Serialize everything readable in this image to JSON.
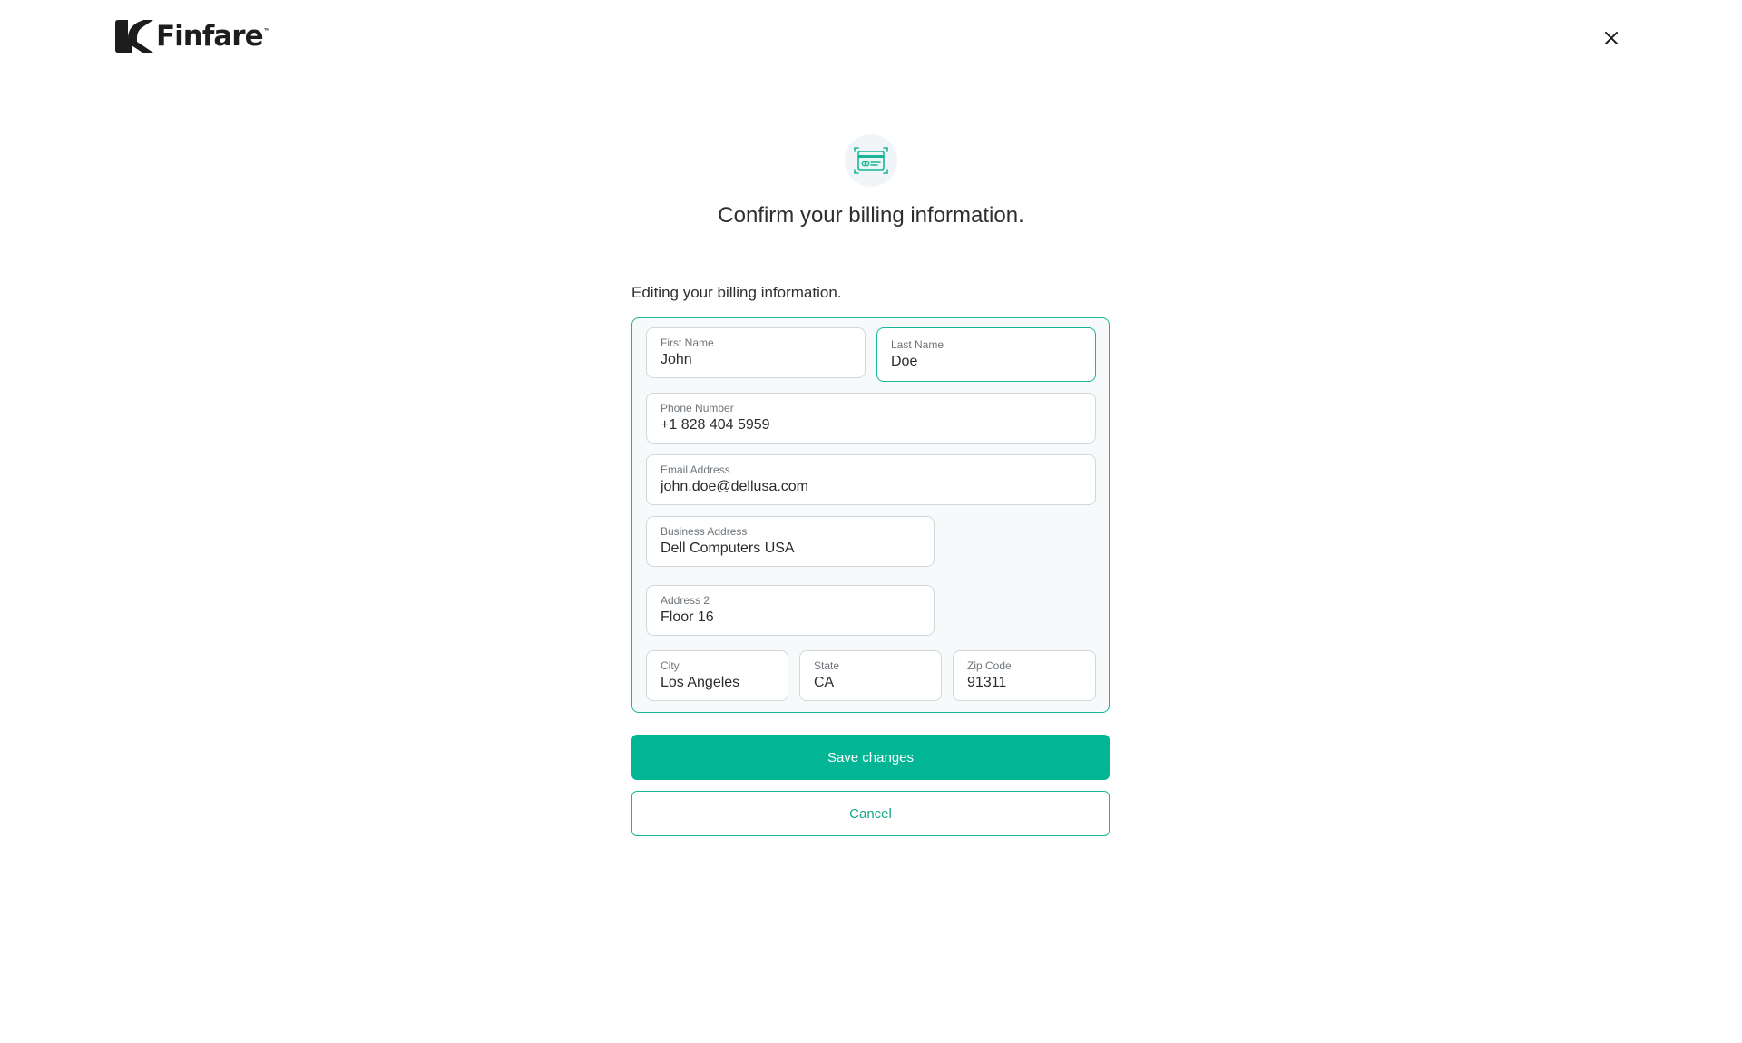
{
  "brand": {
    "name": "Finfare",
    "trademark": "™",
    "accent_color": "#19b597",
    "button_color": "#02b595"
  },
  "header": {
    "close_icon": "close-icon"
  },
  "hero": {
    "icon": "credit-card-icon",
    "title": "Confirm your billing information."
  },
  "form": {
    "section_label": "Editing your billing information.",
    "fields": {
      "first_name": {
        "label": "First Name",
        "value": "John"
      },
      "last_name": {
        "label": "Last Name",
        "value": "Doe"
      },
      "phone": {
        "label": "Phone Number",
        "value": "+1 828 404 5959"
      },
      "email": {
        "label": "Email Address",
        "value": "john.doe@dellusa.com"
      },
      "business_address": {
        "label": "Business Address",
        "value": "Dell Computers USA"
      },
      "address2": {
        "label": "Address 2",
        "value": "Floor 16"
      },
      "city": {
        "label": "City",
        "value": "Los Angeles"
      },
      "state": {
        "label": "State",
        "value": "CA"
      },
      "zip": {
        "label": "Zip Code",
        "value": "91311"
      }
    }
  },
  "actions": {
    "save_label": "Save changes",
    "cancel_label": "Cancel"
  }
}
